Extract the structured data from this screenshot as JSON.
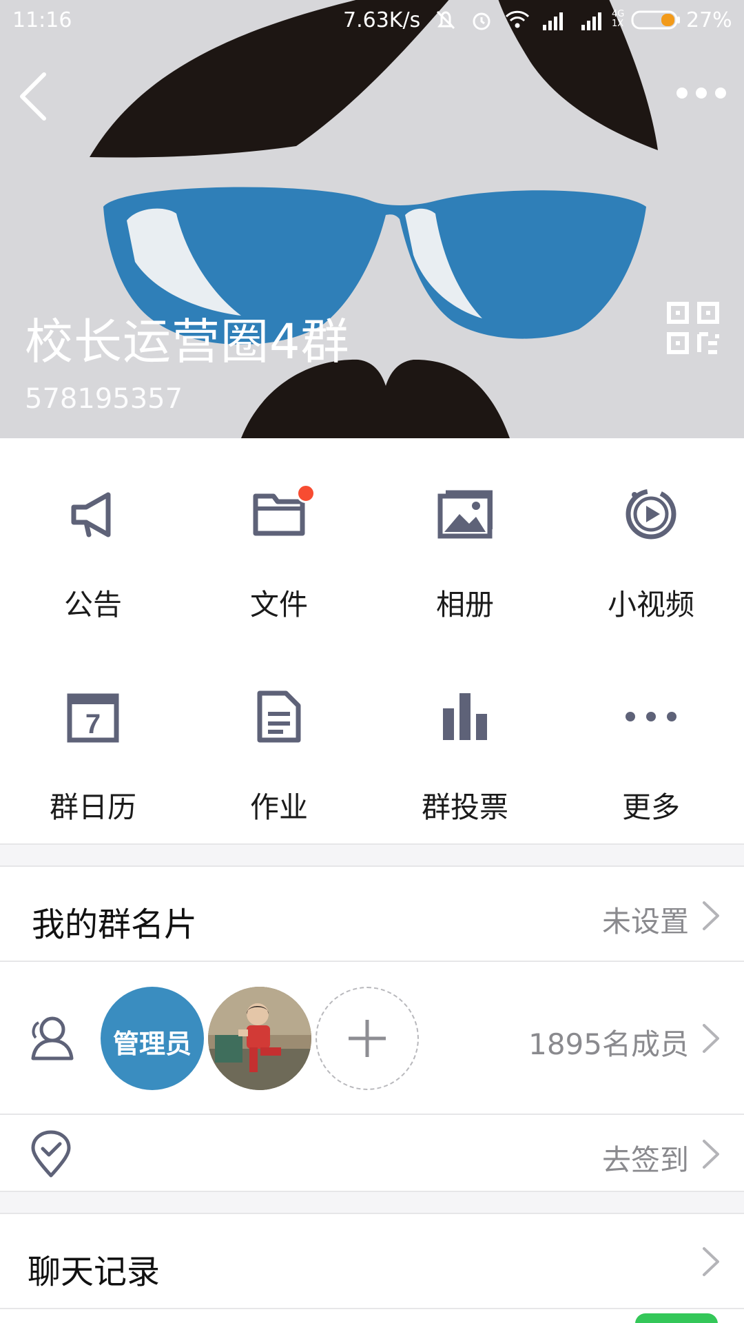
{
  "status_bar": {
    "time": "11:16",
    "net_speed": "7.63K/s",
    "net_type_top": "4G",
    "net_type_bottom": "1X",
    "battery": "27%",
    "icons": [
      "mute-icon",
      "alarm-icon",
      "wifi-icon",
      "signal-icon",
      "signal-2-icon",
      "battery-icon"
    ]
  },
  "header": {
    "title": "校长运营圈4群",
    "group_id": "578195357",
    "back_icon": "chevron-left-icon",
    "more_icon": "more-dots-icon",
    "qr_icon": "qr-code-icon"
  },
  "features": [
    {
      "label": "公告",
      "icon": "megaphone-icon"
    },
    {
      "label": "文件",
      "icon": "folder-icon",
      "badge": true
    },
    {
      "label": "相册",
      "icon": "photo-album-icon"
    },
    {
      "label": "小视频",
      "icon": "video-play-icon"
    },
    {
      "label": "群日历",
      "icon": "calendar-icon",
      "calendar_day": "7"
    },
    {
      "label": "作业",
      "icon": "document-icon"
    },
    {
      "label": "群投票",
      "icon": "bar-chart-icon"
    },
    {
      "label": "更多",
      "icon": "more-dots-icon"
    }
  ],
  "rows": {
    "card": {
      "title": "我的群名片",
      "value": "未设置"
    },
    "members": {
      "admin_label": "管理员",
      "count_text": "1895名成员",
      "icon": "members-icon"
    },
    "checkin": {
      "value": "去签到",
      "icon": "location-check-icon"
    },
    "history": {
      "title": "聊天记录"
    }
  },
  "colors": {
    "icon_gray": "#5e6278",
    "badge_red": "#f74c31",
    "admin_blue": "#3a8dc0",
    "glasses_blue": "#2f7fb8"
  }
}
